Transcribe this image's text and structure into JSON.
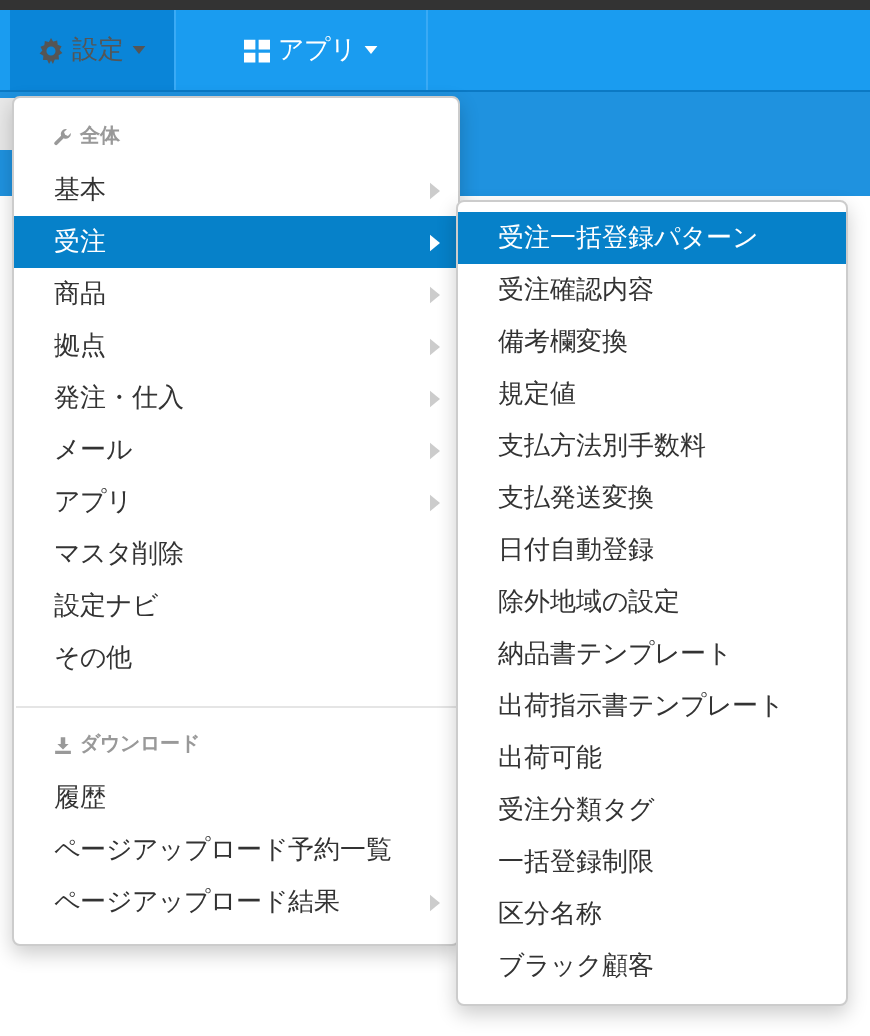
{
  "navbar": {
    "tabs": [
      {
        "label": "設定",
        "selected": true
      },
      {
        "label": "アプリ",
        "selected": false
      }
    ]
  },
  "menu": {
    "sections": [
      {
        "header": "全体",
        "items": [
          {
            "label": "基本",
            "selected": false,
            "has_submenu": true
          },
          {
            "label": "受注",
            "selected": true,
            "has_submenu": true
          },
          {
            "label": "商品",
            "selected": false,
            "has_submenu": true
          },
          {
            "label": "拠点",
            "selected": false,
            "has_submenu": true
          },
          {
            "label": "発注・仕入",
            "selected": false,
            "has_submenu": true
          },
          {
            "label": "メール",
            "selected": false,
            "has_submenu": true
          },
          {
            "label": "アプリ",
            "selected": false,
            "has_submenu": true
          },
          {
            "label": "マスタ削除",
            "selected": false,
            "has_submenu": false
          },
          {
            "label": "設定ナビ",
            "selected": false,
            "has_submenu": false
          },
          {
            "label": "その他",
            "selected": false,
            "has_submenu": false
          }
        ]
      },
      {
        "header": "ダウンロード",
        "items": [
          {
            "label": "履歴",
            "selected": false,
            "has_submenu": false
          },
          {
            "label": "ページアップロード予約一覧",
            "selected": false,
            "has_submenu": false
          },
          {
            "label": "ページアップロード結果",
            "selected": false,
            "has_submenu": true
          }
        ]
      }
    ]
  },
  "submenu": {
    "items": [
      {
        "label": "受注一括登録パターン",
        "selected": true
      },
      {
        "label": "受注確認内容",
        "selected": false
      },
      {
        "label": "備考欄変換",
        "selected": false
      },
      {
        "label": "規定値",
        "selected": false
      },
      {
        "label": "支払方法別手数料",
        "selected": false
      },
      {
        "label": "支払発送変換",
        "selected": false
      },
      {
        "label": "日付自動登録",
        "selected": false
      },
      {
        "label": "除外地域の設定",
        "selected": false
      },
      {
        "label": "納品書テンプレート",
        "selected": false
      },
      {
        "label": "出荷指示書テンプレート",
        "selected": false
      },
      {
        "label": "出荷可能",
        "selected": false
      },
      {
        "label": "受注分類タグ",
        "selected": false
      },
      {
        "label": "一括登録制限",
        "selected": false
      },
      {
        "label": "区分名称",
        "selected": false
      },
      {
        "label": "ブラック顧客",
        "selected": false
      }
    ]
  }
}
